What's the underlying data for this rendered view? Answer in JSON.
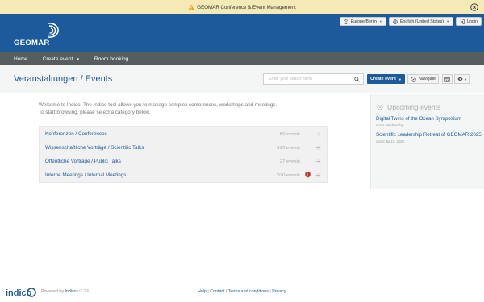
{
  "announcement": {
    "text": "GEOMAR Conference & Event Management",
    "warning_icon": "warning-icon",
    "close_icon": "close-circle-icon"
  },
  "header": {
    "logo_text": "GEOMAR",
    "timezone": "Europe/Berlin",
    "language": "English (United States)",
    "login": "Login",
    "colors": {
      "brand": "#1c5a9c"
    }
  },
  "nav": {
    "items": [
      "Home",
      "Create event",
      "Room booking"
    ]
  },
  "titlebar": {
    "title": "Veranstaltungen / Events",
    "search_placeholder": "Enter your search term",
    "create_event": "Create event",
    "navigate": "Navigate"
  },
  "welcome": {
    "line1": "Welcome to Indico. The Indico tool allows you to manage complex conferences, workshops and meetings.",
    "line2": "To start browsing, please select a category below."
  },
  "categories": [
    {
      "name": "Konferenzen / Conferences",
      "count": "50 events",
      "protected": false
    },
    {
      "name": "Wissenschaftliche Vorträge / Scientific Talks",
      "count": "120 events",
      "protected": false
    },
    {
      "name": "Öffentliche Vorträge / Public Talks",
      "count": "27 events",
      "protected": false
    },
    {
      "name": "Interne Meetings / Internal Meetings",
      "count": "370 events",
      "protected": true
    }
  ],
  "upcoming": {
    "heading": "Upcoming events",
    "events": [
      {
        "title": "Digital Twins of the Ocean Symposium",
        "date": "starts Wednesday"
      },
      {
        "title": "Scientific Leadership Retreat of GEOMAR 2025",
        "date": "starts Jul 10, 2025"
      }
    ]
  },
  "footer": {
    "logo_text": "indico",
    "powered_by": "Powered by",
    "indico_link": "Indico",
    "version": "v3.3.6",
    "links": [
      "Help",
      "Contact",
      "Terms and conditions",
      "Privacy"
    ]
  }
}
